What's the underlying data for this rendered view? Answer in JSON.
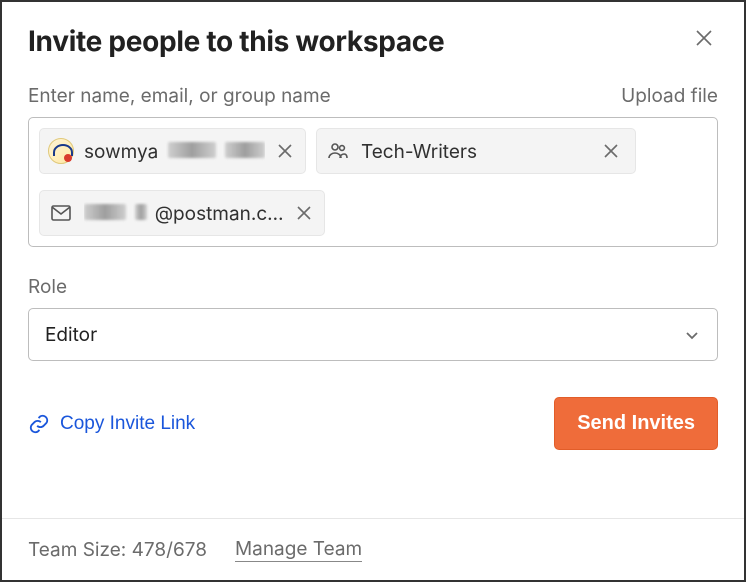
{
  "dialog": {
    "title": "Invite people to this workspace",
    "invitees_label": "Enter name, email, or group name",
    "upload_label": "Upload file",
    "role_label": "Role",
    "role_value": "Editor",
    "copy_link_label": "Copy Invite Link",
    "send_button_label": "Send Invites"
  },
  "chips": [
    {
      "kind": "user",
      "label_prefix": "sowmya",
      "label_redacted": true
    },
    {
      "kind": "group",
      "label": "Tech-Writers"
    },
    {
      "kind": "email",
      "label_redacted_prefix": true,
      "label_suffix": "@postman.c…"
    }
  ],
  "footer": {
    "team_size_label": "Team Size: ",
    "team_size_value": "478/678",
    "manage_team_label": "Manage Team"
  }
}
